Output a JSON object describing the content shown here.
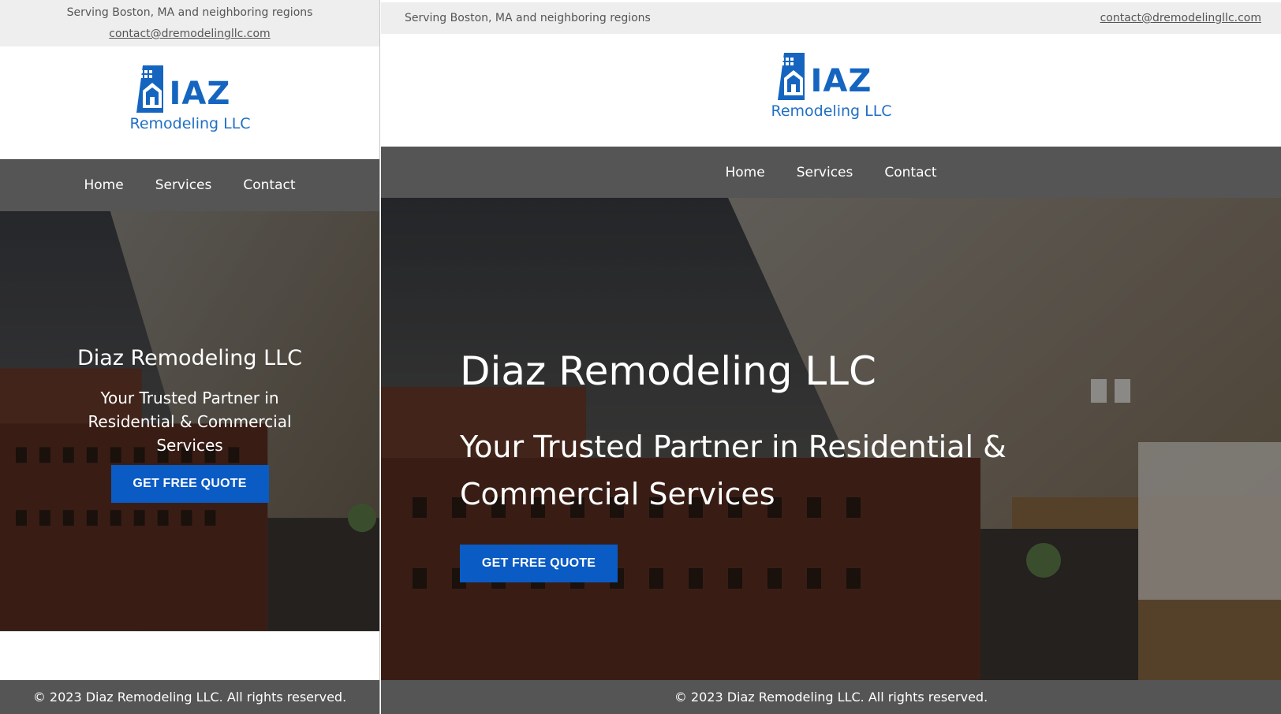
{
  "topbar": {
    "service_area": "Serving Boston, MA and neighboring regions",
    "email": "contact@dremodelingllc.com"
  },
  "logo": {
    "letters": "IAZ",
    "subtitle": "Remodeling LLC",
    "brand_color": "#1565c0",
    "icon": "building-house-logo-icon"
  },
  "nav": {
    "items": [
      {
        "label": "Home"
      },
      {
        "label": "Services"
      },
      {
        "label": "Contact"
      }
    ]
  },
  "hero": {
    "title": "Diaz Remodeling LLC",
    "subtitle": "Your Trusted Partner in Residential & Commercial Services",
    "cta_label": "GET FREE QUOTE",
    "cta_color": "#0a5bc4"
  },
  "footer": {
    "copyright": "© 2023 Diaz Remodeling LLC. All rights reserved."
  },
  "colors": {
    "topbar_bg": "#eeeeee",
    "nav_bg": "#555555",
    "footer_bg": "#555555"
  }
}
